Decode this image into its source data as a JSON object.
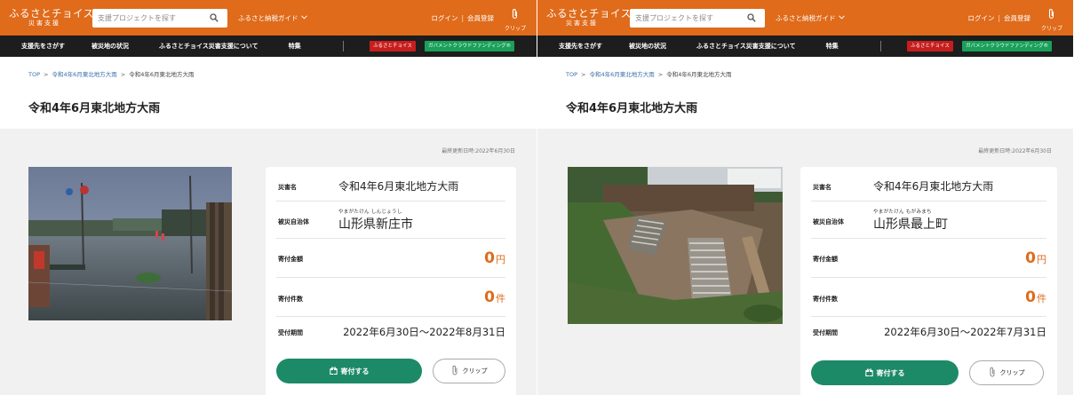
{
  "header": {
    "logo_line1": "ふるさとチョイス",
    "logo_line2": "災害支援",
    "search_placeholder": "支援プロジェクトを探す",
    "guide_label": "ふるさと納税ガイド",
    "login": "ログイン",
    "register": "会員登録",
    "clip_label": "クリップ"
  },
  "nav": {
    "items": [
      "支援先をさがす",
      "被災地の状況",
      "ふるさとチョイス災害支援について",
      "特集"
    ],
    "badge_choice": "ふるさとチョイス",
    "badge_gcf": "ガバメントクラウドファンディング®"
  },
  "colors": {
    "header_orange": "#df6b1b",
    "nav_black": "#1d1d1d",
    "donate_green": "#1d8a67",
    "amount_orange": "#df6b1b"
  },
  "panels": [
    {
      "breadcrumb": {
        "top": "TOP",
        "parent": "令和4年6月東北地方大雨",
        "current": "令和4年6月東北地方大雨"
      },
      "title": "令和4年6月東北地方大雨",
      "updated": "最終更新日時:2022年6月30日",
      "photo_desc": "flooded-street",
      "info": {
        "disaster_label": "災害名",
        "disaster_value": "令和4年6月東北地方大雨",
        "municipality_label": "被災自治体",
        "municipality_ruby": "やまがたけん しんじょうし",
        "municipality_value": "山形県新庄市",
        "amount_label": "寄付金額",
        "amount_value": "0",
        "amount_unit": "円",
        "count_label": "寄付件数",
        "count_value": "0",
        "count_unit": "件",
        "period_label": "受付期間",
        "period_value": "2022年6月30日〜2022年8月31日"
      },
      "donate_label": "寄付する",
      "clip_label": "クリップ"
    },
    {
      "breadcrumb": {
        "top": "TOP",
        "parent": "令和4年6月東北地方大雨",
        "current": "令和4年6月東北地方大雨"
      },
      "title": "令和4年6月東北地方大雨",
      "updated": "最終更新日時:2022年6月30日",
      "photo_desc": "landslide",
      "info": {
        "disaster_label": "災害名",
        "disaster_value": "令和4年6月東北地方大雨",
        "municipality_label": "被災自治体",
        "municipality_ruby": "やまがたけん もがみまち",
        "municipality_value": "山形県最上町",
        "amount_label": "寄付金額",
        "amount_value": "0",
        "amount_unit": "円",
        "count_label": "寄付件数",
        "count_value": "0",
        "count_unit": "件",
        "period_label": "受付期間",
        "period_value": "2022年6月30日〜2022年7月31日"
      },
      "donate_label": "寄付する",
      "clip_label": "クリップ"
    }
  ]
}
